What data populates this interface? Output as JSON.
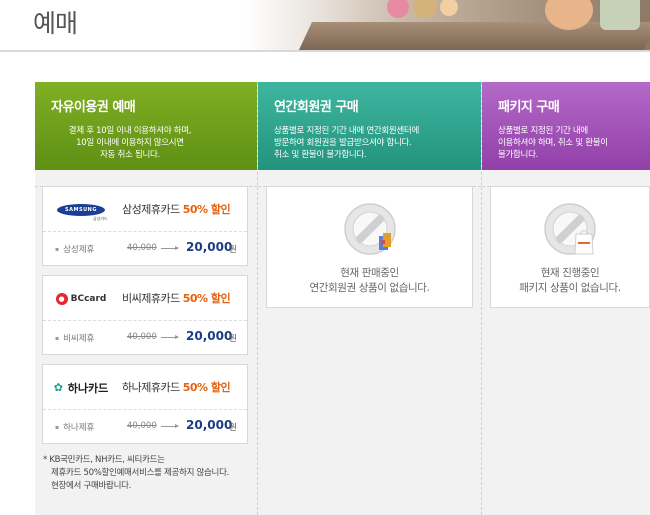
{
  "page": {
    "title": "예매"
  },
  "colors": {
    "free_pass": "#6a9a1a",
    "annual": "#2aa48d",
    "package": "#a050b8",
    "discount": "#e5620f",
    "price": "#1d3c84"
  },
  "columns": {
    "free_pass": {
      "title": "자유이용권 예매",
      "desc": [
        "결제 후 10일 이내 이용하셔야 하며,",
        "10일 이내에 이용하지 않으시면",
        "자동 취소 됩니다."
      ]
    },
    "annual": {
      "title": "연간회원권 구매",
      "desc": [
        "상품별로 지정된 기간 내에 연간회원센터에",
        "방문하여 회원권을 발급받으셔야 합니다.",
        "취소 및 환불이 불가합니다."
      ],
      "empty": [
        "현재 판매중인",
        "연간회원권 상품이 없습니다."
      ]
    },
    "package": {
      "title": "패키지 구매",
      "desc": [
        "상품별로 지정된 기간 내에",
        "이용하셔야 하며, 취소 및 환불이",
        "불가합니다."
      ],
      "empty": [
        "현재 진행중인",
        "패키지 상품이 없습니다."
      ]
    }
  },
  "cards": [
    {
      "logo": "SAMSUNG",
      "logo_sub": "삼성카드",
      "name": "삼성제휴카드",
      "discount": "50% 할인",
      "label": "삼성제휴",
      "old_price": "40,000",
      "new_price": "20,000",
      "unit": "원"
    },
    {
      "logo": "BCcard",
      "logo_sub": "",
      "name": "비씨제휴카드",
      "discount": "50% 할인",
      "label": "비씨제휴",
      "old_price": "40,000",
      "new_price": "20,000",
      "unit": "원"
    },
    {
      "logo": "하나카드",
      "logo_sub": "",
      "name": "하나제휴카드",
      "discount": "50% 할인",
      "label": "하나제휴",
      "old_price": "40,000",
      "new_price": "20,000",
      "unit": "원"
    }
  ],
  "note": [
    "* KB국민카드, NH카드, 씨티카드는",
    "제휴카드 50%할인예매서비스를 제공하지 않습니다.",
    "현장에서 구매바랍니다."
  ],
  "icons": {
    "empty": "no-entry-sign-icon",
    "annual_item": "card-icon",
    "package_item": "shopping-bag-icon"
  }
}
